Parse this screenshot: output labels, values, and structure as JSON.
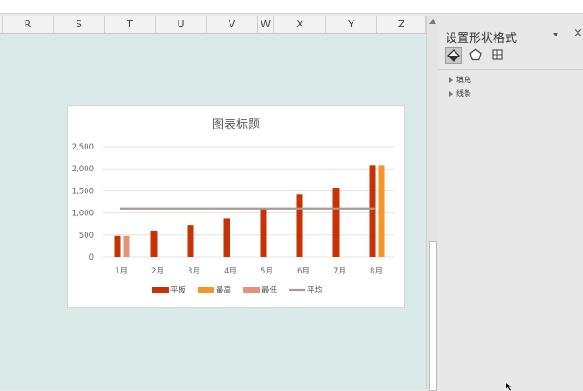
{
  "columns": [
    "R",
    "S",
    "T",
    "U",
    "V",
    "W",
    "X",
    "Y",
    "Z"
  ],
  "format_panel": {
    "title": "设置形状格式",
    "close_glyph": "×",
    "sections": [
      {
        "label": "填充"
      },
      {
        "label": "线条"
      }
    ]
  },
  "chart_data": {
    "type": "bar",
    "title": "图表标题",
    "categories": [
      "1月",
      "2月",
      "3月",
      "4月",
      "5月",
      "6月",
      "7月",
      "8月"
    ],
    "series": [
      {
        "name": "平板",
        "type": "bar",
        "color": "#c83205",
        "values": [
          480,
          600,
          720,
          880,
          1100,
          1420,
          1570,
          2080
        ]
      },
      {
        "name": "最高",
        "type": "bar",
        "color": "#f5962a",
        "values": [
          null,
          null,
          null,
          null,
          null,
          null,
          null,
          2080
        ]
      },
      {
        "name": "最低",
        "type": "bar",
        "color": "#e0957a",
        "values": [
          480,
          null,
          null,
          null,
          null,
          null,
          null,
          null
        ]
      },
      {
        "name": "平均",
        "type": "line",
        "color": "#a89a8c",
        "values": [
          1100,
          1100,
          1100,
          1100,
          1100,
          1100,
          1100,
          1100
        ]
      }
    ],
    "ylim": [
      0,
      2500
    ],
    "yticks": [
      0,
      500,
      1000,
      1500,
      2000,
      2500
    ],
    "ytick_labels": [
      "0",
      "500",
      "1,000",
      "1,500",
      "2,000",
      "2,500"
    ],
    "xlabel": "",
    "ylabel": "",
    "grid": true,
    "legend": "bottom"
  }
}
